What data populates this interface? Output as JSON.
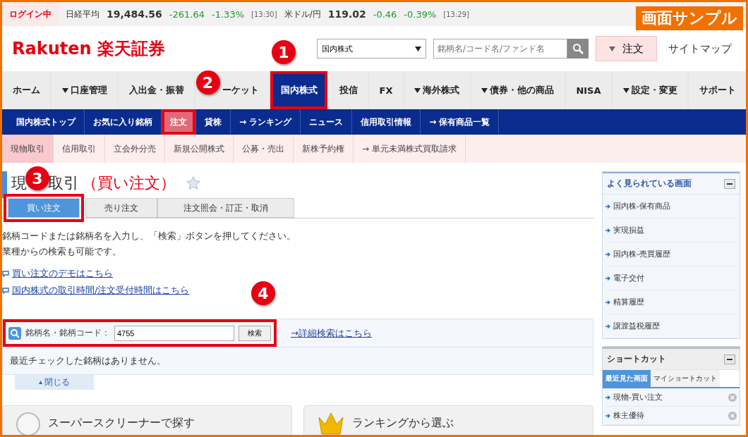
{
  "status_bar": {
    "login": "ログイン中",
    "quotes": [
      {
        "name": "日経平均",
        "value": "19,484.56",
        "change": "-261.64",
        "percent": "-1.33%",
        "time": "[13:30]"
      },
      {
        "name": "米ドル/円",
        "value": "119.02",
        "change": "-0.46",
        "percent": "-0.39%",
        "time": "[13:29]"
      }
    ]
  },
  "sample_badge": "画面サンプル",
  "header": {
    "logo_latin": "Rakuten",
    "logo_kanji": "楽天証券",
    "marker": "1",
    "category_select": "国内株式",
    "search": {
      "placeholder": "銘柄名/コード名/ファンド名"
    },
    "order_button": "注文",
    "sitemap_link": "サイトマップ"
  },
  "main_nav": [
    {
      "label": "ホーム",
      "menu": false,
      "selected": false,
      "highlighted": false
    },
    {
      "label": "口座管理",
      "menu": true,
      "selected": false,
      "highlighted": false
    },
    {
      "label": "入出金・振替",
      "menu": false,
      "selected": false,
      "highlighted": false
    },
    {
      "label": "ーケット",
      "menu": false,
      "selected": false,
      "highlighted": false,
      "marker": "2"
    },
    {
      "label": "国内株式",
      "menu": false,
      "selected": true,
      "highlighted": true
    },
    {
      "label": "投信",
      "menu": false,
      "selected": false,
      "highlighted": false
    },
    {
      "label": "FX",
      "menu": false,
      "selected": false,
      "highlighted": false
    },
    {
      "label": "海外株式",
      "menu": true,
      "selected": false,
      "highlighted": false
    },
    {
      "label": "債券・他の商品",
      "menu": true,
      "selected": false,
      "highlighted": false
    },
    {
      "label": "NISA",
      "menu": false,
      "selected": false,
      "highlighted": false
    },
    {
      "label": "設定・変更",
      "menu": true,
      "selected": false,
      "highlighted": false
    },
    {
      "label": "サポート",
      "menu": false,
      "selected": false,
      "highlighted": false
    }
  ],
  "sub_nav": [
    {
      "label": "国内株式トップ",
      "selected": false,
      "highlighted": false
    },
    {
      "label": "お気に入り銘柄",
      "selected": false,
      "highlighted": false
    },
    {
      "label": "注文",
      "selected": true,
      "highlighted": true
    },
    {
      "label": "貸株",
      "selected": false,
      "highlighted": false
    },
    {
      "label": "→ ランキング",
      "selected": false,
      "highlighted": false
    },
    {
      "label": "ニュース",
      "selected": false,
      "highlighted": false
    },
    {
      "label": "信用取引情報",
      "selected": false,
      "highlighted": false
    },
    {
      "label": "→ 保有商品一覧",
      "selected": false,
      "highlighted": false
    }
  ],
  "order_type_nav": [
    {
      "label": "現物取引",
      "selected": true
    },
    {
      "label": "信用取引",
      "selected": false
    },
    {
      "label": "立会外分売",
      "selected": false
    },
    {
      "label": "新規公開株式",
      "selected": false
    },
    {
      "label": "公募・売出",
      "selected": false
    },
    {
      "label": "新株予約権",
      "selected": false
    },
    {
      "label": "→ 単元未満株式買取請求",
      "selected": false
    }
  ],
  "page": {
    "title_parts": [
      "現",
      "取引"
    ],
    "title_marker": "3",
    "title_suffix": "（買い注文）",
    "tabs": [
      {
        "label": "買い注文",
        "selected": true,
        "highlighted": true
      },
      {
        "label": "売り注文",
        "selected": false,
        "highlighted": false
      },
      {
        "label": "注文照会・訂正・取消",
        "selected": false,
        "highlighted": false
      }
    ],
    "instructions": [
      "銘柄コードまたは銘柄名を入力し、「検索」ボタンを押してください。",
      "業種からの検索も可能です。"
    ],
    "links": [
      "買い注文のデモはこちら",
      "国内株式の取引時間/注文受付時間はこちら"
    ],
    "search_form": {
      "label": "銘柄名・銘柄コード：",
      "value": "4755",
      "button": "検索",
      "highlighted": true,
      "marker": "4",
      "advanced_link": "→詳細検索はこちら"
    },
    "recent": {
      "message": "最近チェックした銘柄はありません。",
      "toggle": "閉じる"
    },
    "cards": [
      {
        "kind": "screener",
        "label": "スーパースクリーナーで探す"
      },
      {
        "kind": "ranking",
        "label": "ランキングから選ぶ"
      }
    ]
  },
  "sidebar": {
    "popular": {
      "title": "よく見られている画面",
      "items": [
        "国内株-保有商品",
        "実現損益",
        "国内株-売買履歴",
        "電子交付",
        "精算履歴",
        "譲渡益税履歴"
      ]
    },
    "shortcuts": {
      "title": "ショートカット",
      "tabs": [
        {
          "label": "最近見た画面",
          "selected": true
        },
        {
          "label": "マイショートカット",
          "selected": false
        }
      ],
      "items": [
        "現物-買い注文",
        "株主優待"
      ]
    }
  }
}
